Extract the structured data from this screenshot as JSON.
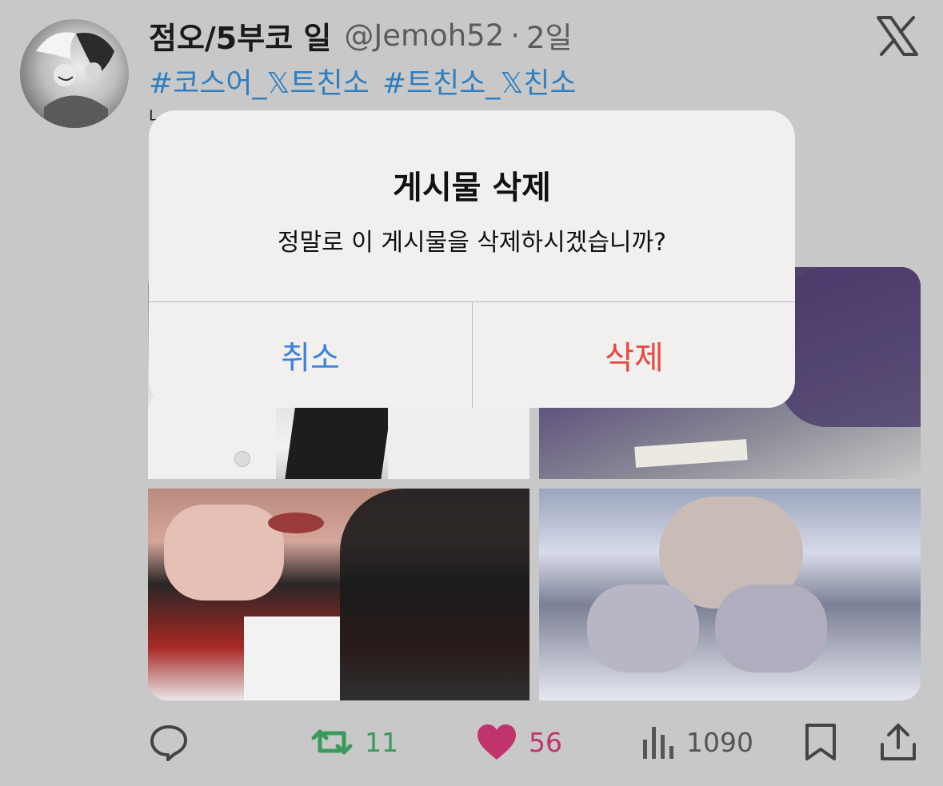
{
  "tweet": {
    "display_name": "점오/5부코 일",
    "handle": "@Jemoh52",
    "separator": "·",
    "time": "2일",
    "hashtags": [
      "#코스어_𝕏트친소",
      "#트친소_𝕏친소"
    ],
    "text_peek": "나"
  },
  "dialog": {
    "title": "게시물 삭제",
    "message": "정말로 이 게시물을 삭제하시겠습니까?",
    "cancel_label": "취소",
    "delete_label": "삭제",
    "cancel_color": "#3a83e3",
    "delete_color": "#e5493f"
  },
  "actions": {
    "retweet_count": "11",
    "like_count": "56",
    "views_count": "1090",
    "retweet_color": "#3a9a5c",
    "like_color": "#c0336b"
  },
  "icons": [
    "x-logo-icon",
    "reply-icon",
    "retweet-icon",
    "heart-icon",
    "views-icon",
    "bookmark-icon",
    "share-icon"
  ]
}
